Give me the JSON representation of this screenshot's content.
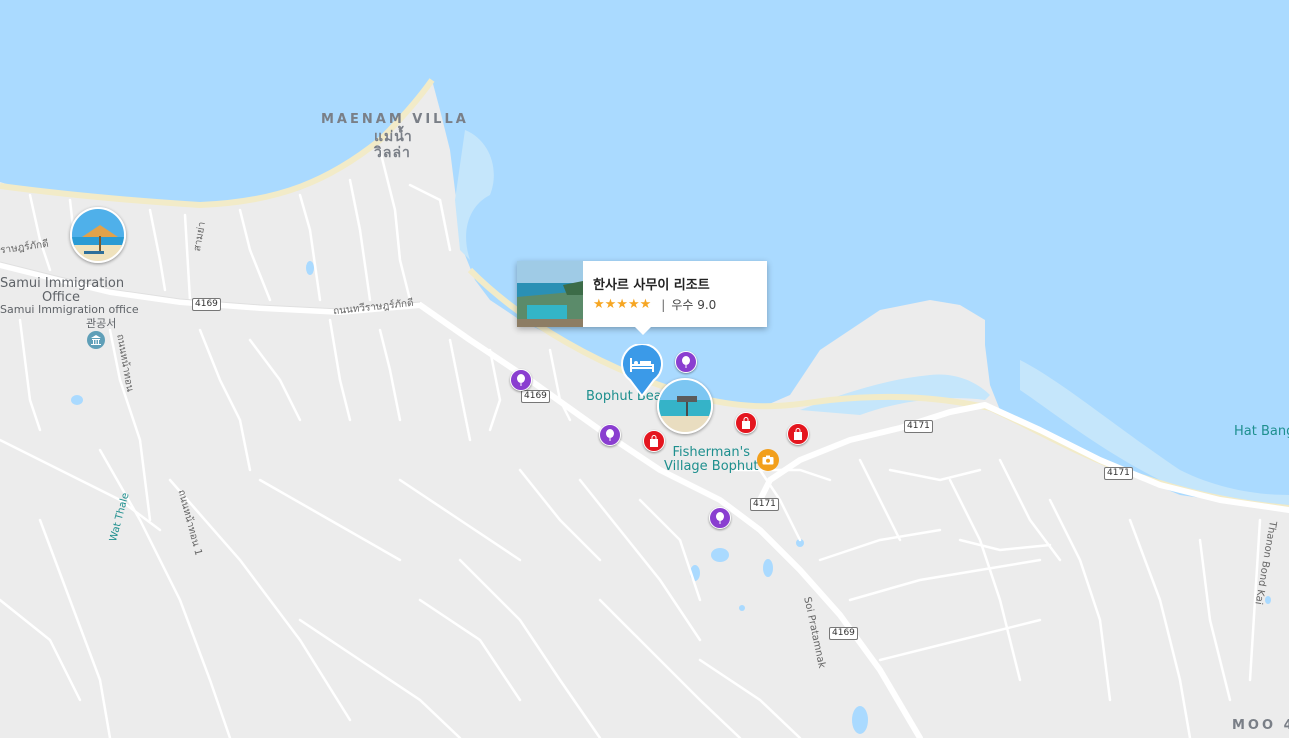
{
  "map": {
    "colors": {
      "water": "#aadaff",
      "land": "#ececec",
      "road": "#ffffff",
      "beach": "#f2ebc8",
      "hotel_pin": "#3b9ae8",
      "attraction": "#8a3ed0",
      "shopping": "#e4161f"
    },
    "area_labels": {
      "maenam_en": "MAENAM VILLA",
      "maenam_th1": "แม่น้ำ",
      "maenam_th2": "วิลล่า",
      "hat_bang": "Hat Bang",
      "moo": "MOO 4"
    },
    "poi_labels": {
      "immigration_1": "Samui Immigration",
      "immigration_2": "Office",
      "immigration_th": "Samui Immigration office",
      "immigration_ko": "관공서",
      "bophut_beach": "Bophut Beach",
      "fishermans_1": "Fisherman's",
      "fishermans_2": "Village Bophut",
      "wat_thale": "Wat Thale"
    },
    "road_labels": {
      "thawiratchaphakdi": "ถนนทวีราษฎร์ภักดี",
      "thawiratchaphakdi_left": "ราษฎร์ภักดี",
      "sol_pratamnak": "Soi Pratamnak",
      "thanon_bond_kai": "Thanon Bond Kai",
      "v_road_1": "ถนนหน้าทอน",
      "v_road_2": "ถนนหน้าทอน 1",
      "small_road": "สามย่า"
    },
    "route_shields": [
      "4169",
      "4169",
      "4169",
      "4171",
      "4171",
      "4171"
    ],
    "popup": {
      "title": "한사르 사무이 리조트",
      "stars": "★★★★★",
      "rating_text": "우수 9.0",
      "star_count": 5
    },
    "icons": {
      "hotel": "bed-icon",
      "attraction": "balloon-icon",
      "shopping": "shopping-bag-icon",
      "photo_spot": "camera-icon",
      "government": "building-icon"
    }
  }
}
